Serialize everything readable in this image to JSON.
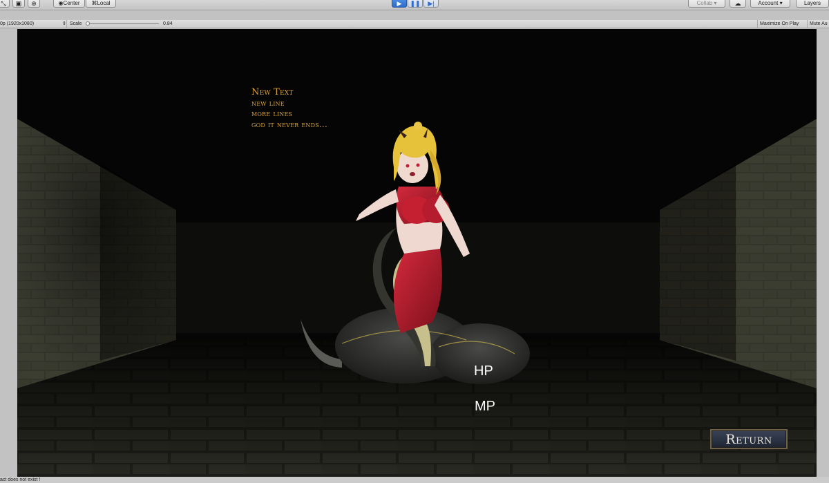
{
  "toolbar": {
    "pivot_label": "Center",
    "space_label": "Local",
    "collab_label": "Collab ▾",
    "account_label": "Account",
    "layers_label": "Layers"
  },
  "game_view": {
    "resolution": "0p (1920x1080)",
    "scale_label": "Scale",
    "scale_value": "0.84",
    "maximize_label": "Maximize On Play",
    "mute_label": "Mute Au"
  },
  "game": {
    "text_lines": [
      "New Text",
      "new line",
      "more lines",
      "god it never ends..."
    ],
    "hp_label": "HP",
    "mp_label": "MP",
    "return_label": "Return"
  },
  "console": {
    "message": "act does not exist !"
  },
  "colors": {
    "game_text": "#d9a23c",
    "play_button": "#2d6cc8",
    "dress": "#b01a2a",
    "hair": "#e6c13a"
  }
}
